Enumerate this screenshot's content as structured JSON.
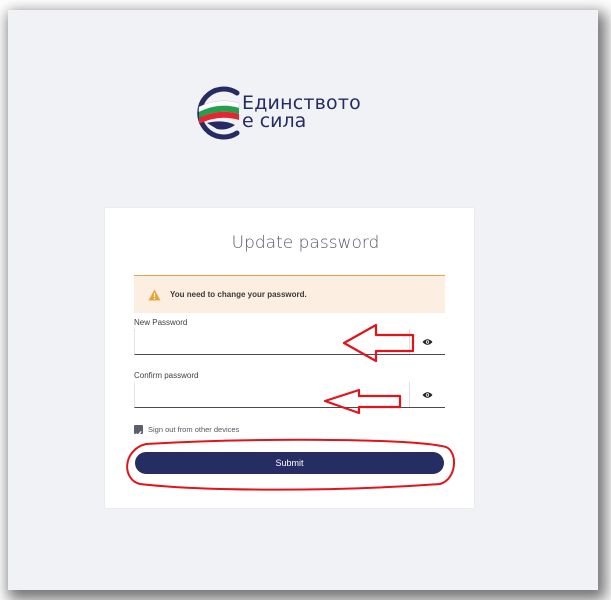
{
  "logo": {
    "line1": "Единството",
    "line2": "е сила"
  },
  "form": {
    "title": "Update password",
    "alert": "You need to change your password.",
    "new_password_label": "New Password",
    "new_password_value": "",
    "confirm_password_label": "Confirm password",
    "confirm_password_value": "",
    "signout_label": "Sign out from other devices",
    "signout_checked": true,
    "submit_label": "Submit"
  },
  "icons": {
    "alert": "warning-icon",
    "reveal": "eye-icon",
    "logo": "flag-logo-icon"
  },
  "colors": {
    "brand": "#262d62",
    "alert_bg": "#fdeee2",
    "alert_border": "#e9a055",
    "warning": "#e8a43a",
    "annotation": "#e2141b",
    "page_bg": "#f1f2f5"
  }
}
